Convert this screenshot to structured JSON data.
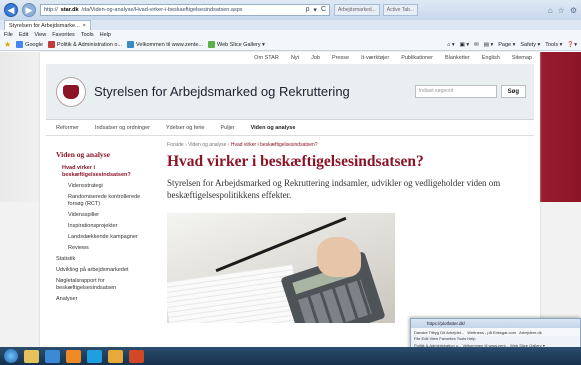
{
  "browser": {
    "address": "http://",
    "address_domain": "star.dk",
    "address_path": "/da/Viden-og-analyse/Hvad-virker-i-beskaeftigelsesindsatsen.aspx",
    "address_tools": [
      "ρ",
      "▾",
      "C"
    ],
    "bg_tabs": [
      "Arbejdsmarked...",
      "Active Tab..."
    ],
    "window_buttons": [
      "⌂",
      "☆",
      "⚙"
    ],
    "current_tab": "Styrelsen for Arbejdsmarke...",
    "menu": [
      "File",
      "Edit",
      "View",
      "Favorites",
      "Tools",
      "Help"
    ],
    "favorites": [
      {
        "label": "Google",
        "color": "#4285f4"
      },
      {
        "label": "Politik & Administration o...",
        "color": "#c23b3b"
      },
      {
        "label": "Velkommen til www.zente...",
        "color": "#3b8ac2"
      },
      {
        "label": "Web Slice Gallery ▾",
        "color": "#5ab04a"
      }
    ],
    "commands": [
      "⌂ ▾",
      "▣ ▾",
      "✉",
      "▤ ▾",
      "Page ▾",
      "Safety ▾",
      "Tools ▾",
      "❓▾"
    ]
  },
  "site": {
    "util_links": [
      "Om STAR",
      "Nyt",
      "Job",
      "Presse",
      "It-værktøjer",
      "Publikationer",
      "Blanketter",
      "English",
      "Sitemap"
    ],
    "brand": "Styrelsen for Arbejdsmarked og Rekruttering",
    "search_placeholder": "Indtast søgeord",
    "search_button": "Søg",
    "main_nav": [
      "Reformer",
      "Indsatser og ordninger",
      "Ydelser og ferie",
      "Puljer",
      "Viden og analyse"
    ],
    "active_nav": "Viden og analyse",
    "breadcrumb": [
      "Forside",
      "Viden og analyse"
    ],
    "breadcrumb_current": "Hvad virker i beskæftigelsesindsatsen?",
    "left_heading": "Viden og analyse",
    "left_active": "Hvad virker i beskæftigelsesindsatsen?",
    "left_sub": [
      "Vidensstrategi",
      "Randomiserede kontrollerede forsøg (RCT)",
      "Vidensspiller",
      "Inspirationsprojekter",
      "Landsdækkende kampagner",
      "Reviews"
    ],
    "left_top": [
      "Statistik",
      "Udvikling på arbejdsmarkedet",
      "Nøgletalsrapport for beskæftigelsesindsatsen",
      "Analyser"
    ],
    "title": "Hvad virker i beskæftigelsesindsatsen?",
    "lead": "Styrelsen for Arbejdsmarked og Rekruttering indsamler, udvikler og vedligeholder viden om beskæftigelsespolitikkens effekter."
  },
  "peek": {
    "title": "https://plotfatter.dk/",
    "tabs": [
      "Danske Tilbyg Dit Arbejdet...",
      "Wettness - på Eriksgar.com",
      "Arbejdere.dk"
    ],
    "menu": "File  Edit  View  Favorites  Tools  Help",
    "favs": "Politik & Administration o...  Velkommen til www.zent...  Web Slice Gallery ▾"
  }
}
